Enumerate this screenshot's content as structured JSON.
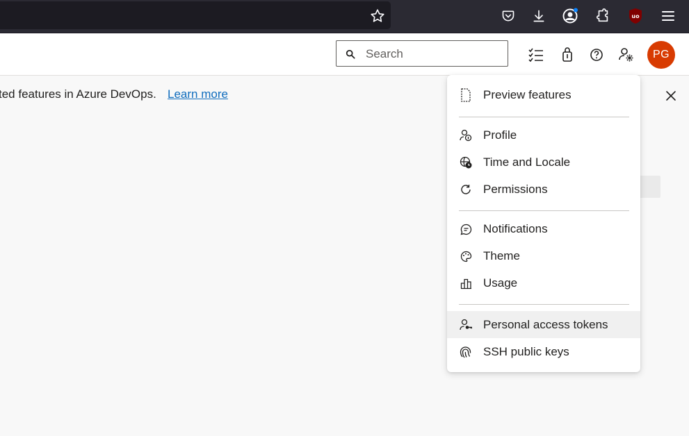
{
  "browser": {
    "icons": [
      "star-bookmark-icon",
      "pocket-icon",
      "download-icon",
      "account-icon",
      "extensions-icon",
      "ublock-icon",
      "hamburger-menu-icon"
    ]
  },
  "header": {
    "search_placeholder": "Search",
    "avatar_initials": "PG",
    "avatar_color": "#d83b01",
    "icons": [
      "task-list-icon",
      "shopping-bag-icon",
      "help-icon",
      "user-settings-icon"
    ]
  },
  "banner": {
    "text": "ted features in Azure DevOps.",
    "link": "Learn more"
  },
  "user_menu": {
    "groups": [
      [
        {
          "label": "Preview features",
          "icon": "document-icon"
        }
      ],
      [
        {
          "label": "Profile",
          "icon": "profile-icon"
        },
        {
          "label": "Time and Locale",
          "icon": "globe-clock-icon"
        },
        {
          "label": "Permissions",
          "icon": "refresh-icon"
        }
      ],
      [
        {
          "label": "Notifications",
          "icon": "chat-bubble-icon"
        },
        {
          "label": "Theme",
          "icon": "palette-icon"
        },
        {
          "label": "Usage",
          "icon": "bar-chart-icon"
        }
      ],
      [
        {
          "label": "Personal access tokens",
          "icon": "person-key-icon",
          "hovered": true
        },
        {
          "label": "SSH public keys",
          "icon": "fingerprint-icon"
        }
      ]
    ]
  },
  "colors": {
    "browser_bg": "#2b2a33",
    "link": "#0f6cbd",
    "accent_badge": "#0a84ff",
    "ublock": "#800000"
  }
}
